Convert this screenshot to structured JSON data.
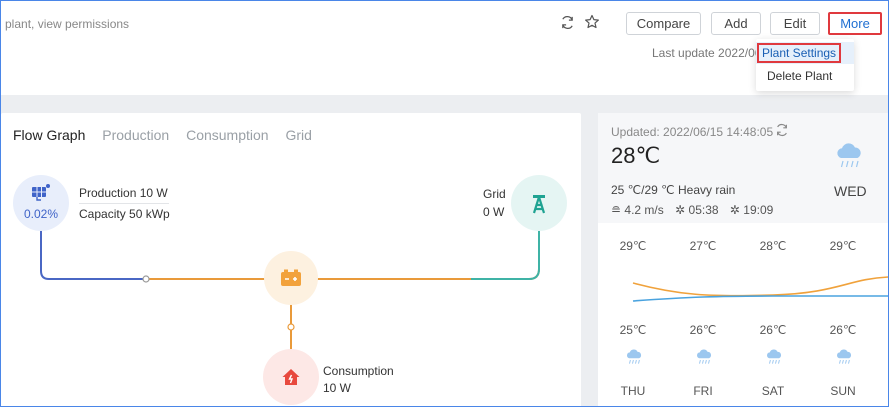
{
  "header": {
    "subtitle": "plant, view permissions",
    "buttons": {
      "compare": "Compare",
      "add": "Add",
      "edit": "Edit",
      "more": "More"
    },
    "last_update": "Last update 2022/06"
  },
  "more_menu": {
    "items": [
      "Plant Settings",
      "Delete Plant"
    ]
  },
  "flow": {
    "tabs": [
      "Flow Graph",
      "Production",
      "Consumption",
      "Grid"
    ],
    "production": {
      "label": "Production 10 W",
      "capacity": "Capacity 50 kWp",
      "percent": "0.02%"
    },
    "grid": {
      "label": "Grid",
      "value": "0 W"
    },
    "consumption": {
      "label": "Consumption",
      "value": "10 W"
    }
  },
  "weather": {
    "updated": "Updated: 2022/06/15 14:48:05",
    "current_temp": "28℃",
    "range_desc": "25 ℃/29 ℃ Heavy rain",
    "today": "WED",
    "wind": "4.2 m/s",
    "sunrise": "05:38",
    "sunset": "19:09",
    "forecast": [
      {
        "high": "29℃",
        "low": "25℃",
        "day": "THU"
      },
      {
        "high": "27℃",
        "low": "26℃",
        "day": "FRI"
      },
      {
        "high": "28℃",
        "low": "26℃",
        "day": "SAT"
      },
      {
        "high": "29℃",
        "low": "26℃",
        "day": "SUN"
      }
    ],
    "colors": {
      "high_line": "#f0a23c",
      "low_line": "#4aa3df"
    }
  }
}
